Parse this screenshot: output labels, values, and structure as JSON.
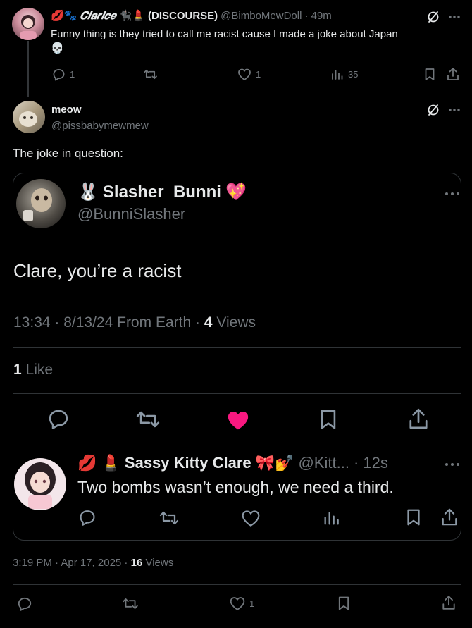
{
  "reply_tweet": {
    "display_name_prefix": "💋🐾",
    "display_name": "𝑪𝒍𝒂𝒓𝒊𝒄𝒆",
    "display_name_suffix": "🐈‍⬛💄",
    "display_name_tag": "(DISCOURSE)",
    "handle": "@BimboMewDoll",
    "time": "· 49m",
    "text": "Funny thing is they tried to call me racist cause I made a joke about Japan",
    "emoji": "💀",
    "replies": "1",
    "reposts": "",
    "likes": "1",
    "views": "35"
  },
  "main_tweet": {
    "display_name": "meow",
    "handle": "@pissbabymewmew",
    "text": "The joke in question:",
    "timestamp": "3:19 PM · Apr 17, 2025 ·",
    "view_count": "16",
    "view_label": "Views",
    "replies": "",
    "reposts": "",
    "likes": "1"
  },
  "quoted_screenshot": {
    "author": {
      "prefix_emoji": "🐰",
      "display_name": "Slasher_Bunni",
      "suffix_emoji": "💖",
      "handle": "@BunniSlasher"
    },
    "text": "Clare, you’re a racist",
    "meta_prefix": "13:34 · 8/13/24 From Earth ·",
    "view_count": "4",
    "view_label": "Views",
    "like_count": "1",
    "like_label": "Like",
    "reply": {
      "prefix_emoji": "💋 💄",
      "display_name": "Sassy Kitty Clare",
      "suffix_emoji": "🎀💅",
      "handle": "@Kitt...",
      "time": "· 12s",
      "text": "Two bombs wasn’t enough, we need a third."
    }
  },
  "colors": {
    "background": "#000000",
    "text": "#e7e9ea",
    "muted": "#71767b",
    "border": "#2f3336",
    "like_pink": "#f91880"
  }
}
